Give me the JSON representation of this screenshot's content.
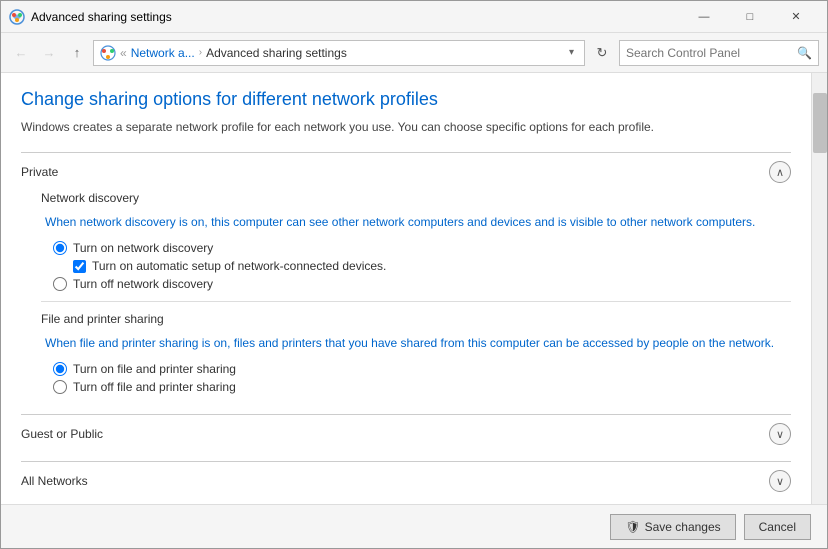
{
  "window": {
    "title": "Advanced sharing settings",
    "min_label": "—",
    "max_label": "□",
    "close_label": "✕"
  },
  "address_bar": {
    "back_label": "←",
    "forward_label": "→",
    "up_label": "↑",
    "breadcrumb_icon": "🌐",
    "breadcrumb_parent": "Network a...",
    "breadcrumb_current": "Advanced sharing settings",
    "refresh_label": "↻",
    "search_placeholder": "Search Control Panel",
    "search_icon": "🔍"
  },
  "main": {
    "page_title": "Change sharing options for different network profiles",
    "page_description": "Windows creates a separate network profile for each network you use. You can choose specific options for each profile.",
    "private_section": {
      "title": "Private",
      "toggle_icon": "∧",
      "network_discovery": {
        "title": "Network discovery",
        "description": "When network discovery is on, this computer can see other network computers and devices and is visible to other network computers.",
        "radio_on_label": "Turn on network discovery",
        "checkbox_label": "Turn on automatic setup of network-connected devices.",
        "radio_off_label": "Turn off network discovery"
      },
      "file_sharing": {
        "title": "File and printer sharing",
        "description": "When file and printer sharing is on, files and printers that you have shared from this computer can be accessed by people on the network.",
        "radio_on_label": "Turn on file and printer sharing",
        "radio_off_label": "Turn off file and printer sharing"
      }
    },
    "guest_public_section": {
      "title": "Guest or Public",
      "toggle_icon": "∨"
    },
    "all_networks_section": {
      "title": "All Networks",
      "toggle_icon": "∨"
    }
  },
  "footer": {
    "save_icon": "🛡",
    "save_label": "Save changes",
    "cancel_label": "Cancel"
  }
}
